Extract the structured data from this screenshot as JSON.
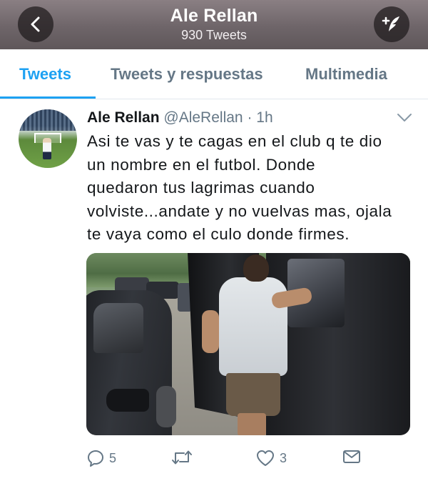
{
  "header": {
    "title": "Ale Rellan",
    "subtitle": "930 Tweets",
    "back_icon": "chevron-left-icon",
    "compose_icon": "compose-feather-icon",
    "background": "#6e6569"
  },
  "tabs": [
    {
      "label": "Tweets",
      "active": true
    },
    {
      "label": "Tweets y respuestas",
      "active": false
    },
    {
      "label": "Multimedia",
      "active": false
    }
  ],
  "accent_color": "#1da1f2",
  "tweet": {
    "name": "Ale Rellan",
    "handle": "@AleRellan",
    "separator": "·",
    "time": "1h",
    "lines": [
      "Asi te vas y te cagas en el club q te dio",
      "un nombre en el futbol. Donde",
      "quedaron tus lagrimas cuando",
      "volviste...andate y no vuelvas mas, ojala",
      "te vaya como el culo donde firmes."
    ],
    "actions": {
      "reply_count": "5",
      "retweet_count": "",
      "like_count": "3"
    }
  }
}
